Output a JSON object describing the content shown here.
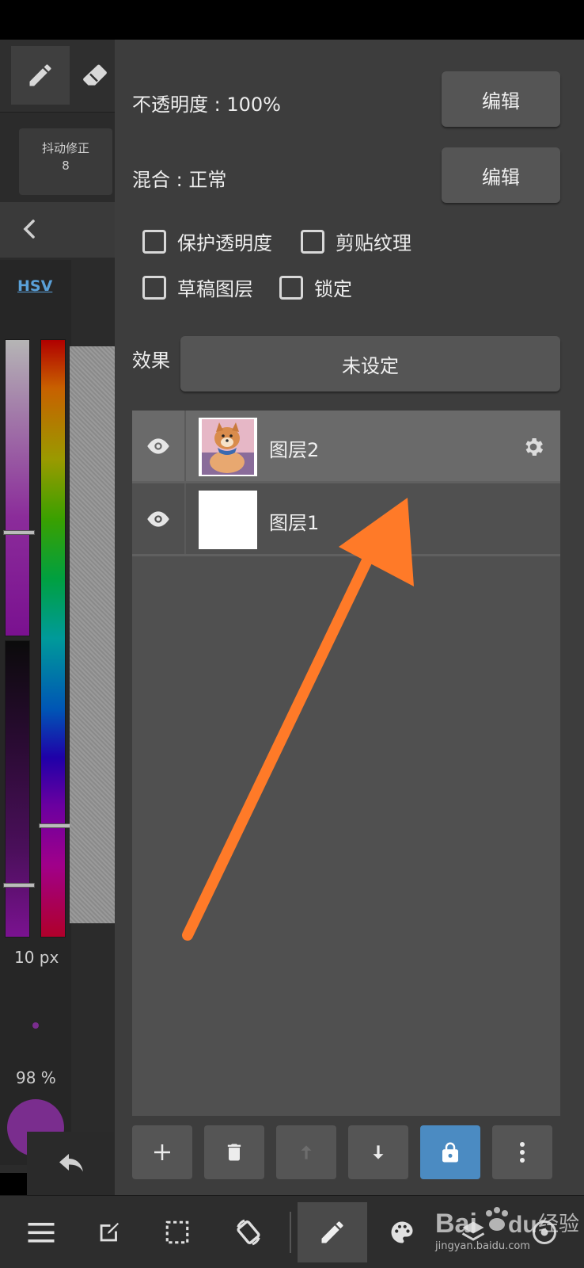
{
  "brush": {
    "stabilizer_label": "抖动修正",
    "stabilizer_value": "8",
    "color_mode": "HSV",
    "size": "10 px",
    "opacity": "98 %",
    "current_color": "#7a2d8e",
    "hue_level": 0.82,
    "saturation_level": 0.32,
    "brightness_level": 0.04
  },
  "layer_properties": {
    "opacity_label": "不透明度 : 100%",
    "blend_label": "混合 : 正常",
    "edit_label": "编辑",
    "checkboxes": [
      {
        "label": "保护透明度",
        "checked": false
      },
      {
        "label": "剪贴纹理",
        "checked": false
      },
      {
        "label": "草稿图层",
        "checked": false
      },
      {
        "label": "锁定",
        "checked": false
      }
    ],
    "effect_label": "效果",
    "effect_value": "未设定"
  },
  "layers": [
    {
      "name": "图层2",
      "visible": true,
      "selected": true,
      "thumbnail": "dog-photo"
    },
    {
      "name": "图层1",
      "visible": true,
      "selected": false,
      "thumbnail": "blank-white"
    }
  ],
  "layer_toolbar": [
    "plus-icon",
    "trash-icon",
    "arrow-up-icon",
    "arrow-down-icon",
    "lock-icon",
    "more-vertical-icon"
  ],
  "bottom_nav": [
    "menu-icon",
    "edit-note-icon",
    "selection-icon",
    "rotate-icon",
    "pen-icon",
    "palette-icon",
    "layers-icon",
    "settings-icon"
  ],
  "watermark": {
    "text": "jingyan.baidu.com"
  },
  "colors": {
    "accent_lock": "#4b8bc2",
    "annotation_arrow": "#ff7a28",
    "panel_bg": "#3d3d3d"
  }
}
